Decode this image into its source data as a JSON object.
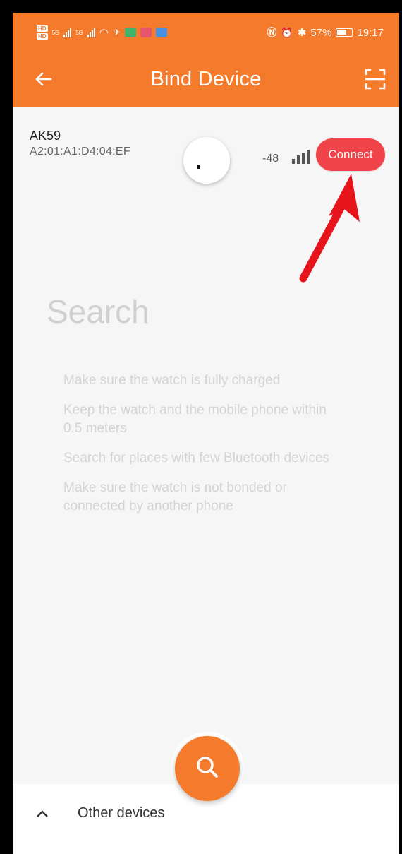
{
  "statusbar": {
    "network_labels": [
      "HD",
      "HD"
    ],
    "signal_labels": [
      "5G",
      "5G"
    ],
    "battery": "57%",
    "time": "19:17"
  },
  "header": {
    "title": "Bind Device",
    "back_icon": "arrow-left-icon",
    "scan_icon": "scan-icon",
    "background": "#f47b2c"
  },
  "device": {
    "name": "AK59",
    "mac": "A2:01:A1:D4:04:EF",
    "rssi": "-48",
    "connect_label": "Connect",
    "connect_color": "#f0434a"
  },
  "search": {
    "heading": "Search",
    "tips": [
      "Make sure the watch is fully charged",
      "Keep the watch and the mobile phone within 0.5 meters",
      "Search for places with few Bluetooth devices",
      "Make sure the watch is not bonded or connected by another phone"
    ]
  },
  "bottom": {
    "other_devices_label": "Other devices",
    "fab_icon": "search-icon"
  }
}
